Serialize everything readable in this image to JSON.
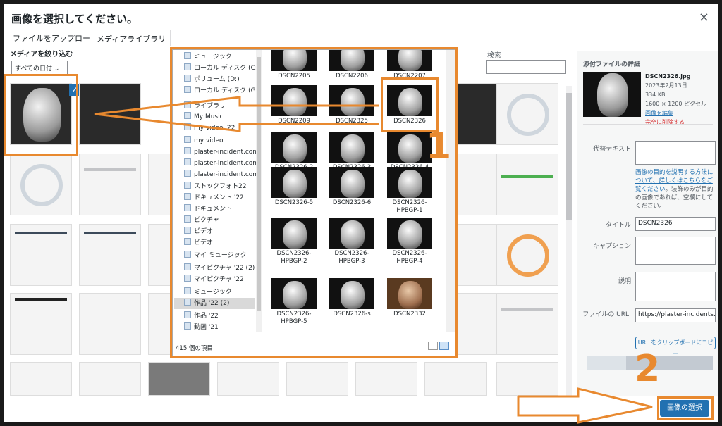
{
  "modal": {
    "title": "画像を選択してください。",
    "close": "×"
  },
  "tabs": [
    {
      "label": "ファイルをアップロード"
    },
    {
      "label": "メディアライブラリ"
    }
  ],
  "filter": {
    "label": "メディアを絞り込む",
    "date_select": "すべての日付 ⌄"
  },
  "search": {
    "label": "検索"
  },
  "explorer": {
    "nav": [
      "ミュージック",
      "ローカル ディスク (C:)",
      "ボリューム (D:)",
      "ローカル ディスク (G:)",
      "ライブラリ",
      "My Music",
      "my video '22",
      "my video",
      "plaster-incident.com.f",
      "plaster-incident.com.f",
      "plaster-incident.com.f",
      "ストックフォト22",
      "ドキュメント '22",
      "ドキュメント",
      "ピクチャ",
      "ビデオ",
      "ビデオ",
      "マイ ミュージック",
      "マイピクチャ '22 (2)",
      "マイピクチャ '22",
      "ミュージック",
      "作品 '22 (2)",
      "作品 '22",
      "動画 '21"
    ],
    "files": [
      "DSCN2205",
      "DSCN2206",
      "DSCN2207",
      "DSCN2209",
      "DSCN2325",
      "DSCN2326",
      "DSCN2326-2",
      "DSCN2326-3",
      "DSCN2326-4",
      "DSCN2326-5",
      "DSCN2326-6",
      "DSCN2326-HPBGP-1",
      "DSCN2326-HPBGP-2",
      "DSCN2326-HPBGP-3",
      "DSCN2326-HPBGP-4",
      "DSCN2326-HPBGP-5",
      "DSCN2326-s",
      "DSCN2332"
    ],
    "status": "415 個の項目"
  },
  "sidebar": {
    "heading": "添付ファイルの詳細",
    "filename": "DSCN2326.jpg",
    "date": "2023年2月13日",
    "size": "334 KB",
    "dimensions": "1600 × 1200 ピクセル",
    "edit_link": "画像を編集",
    "delete_link": "完全に削除する",
    "alt_label": "代替テキスト",
    "help_link": "画像の目的を説明する方法について、詳しくはこちらをご覧ください",
    "help_text": "。装飾のみが目的の画像であれば、空欄にしてください。",
    "title_label": "タイトル",
    "title_value": "DSCN2326",
    "caption_label": "キャプション",
    "desc_label": "説明",
    "url_label": "ファイルの URL:",
    "url_value": "https://plaster-incidents.co",
    "copy_button": "URL をクリップボードにコピー"
  },
  "footer": {
    "select_button": "画像の選択"
  },
  "annotations": {
    "num1": "1",
    "num2": "2"
  },
  "colors": {
    "accent": "#2271b1",
    "annotation": "#e8892f"
  }
}
